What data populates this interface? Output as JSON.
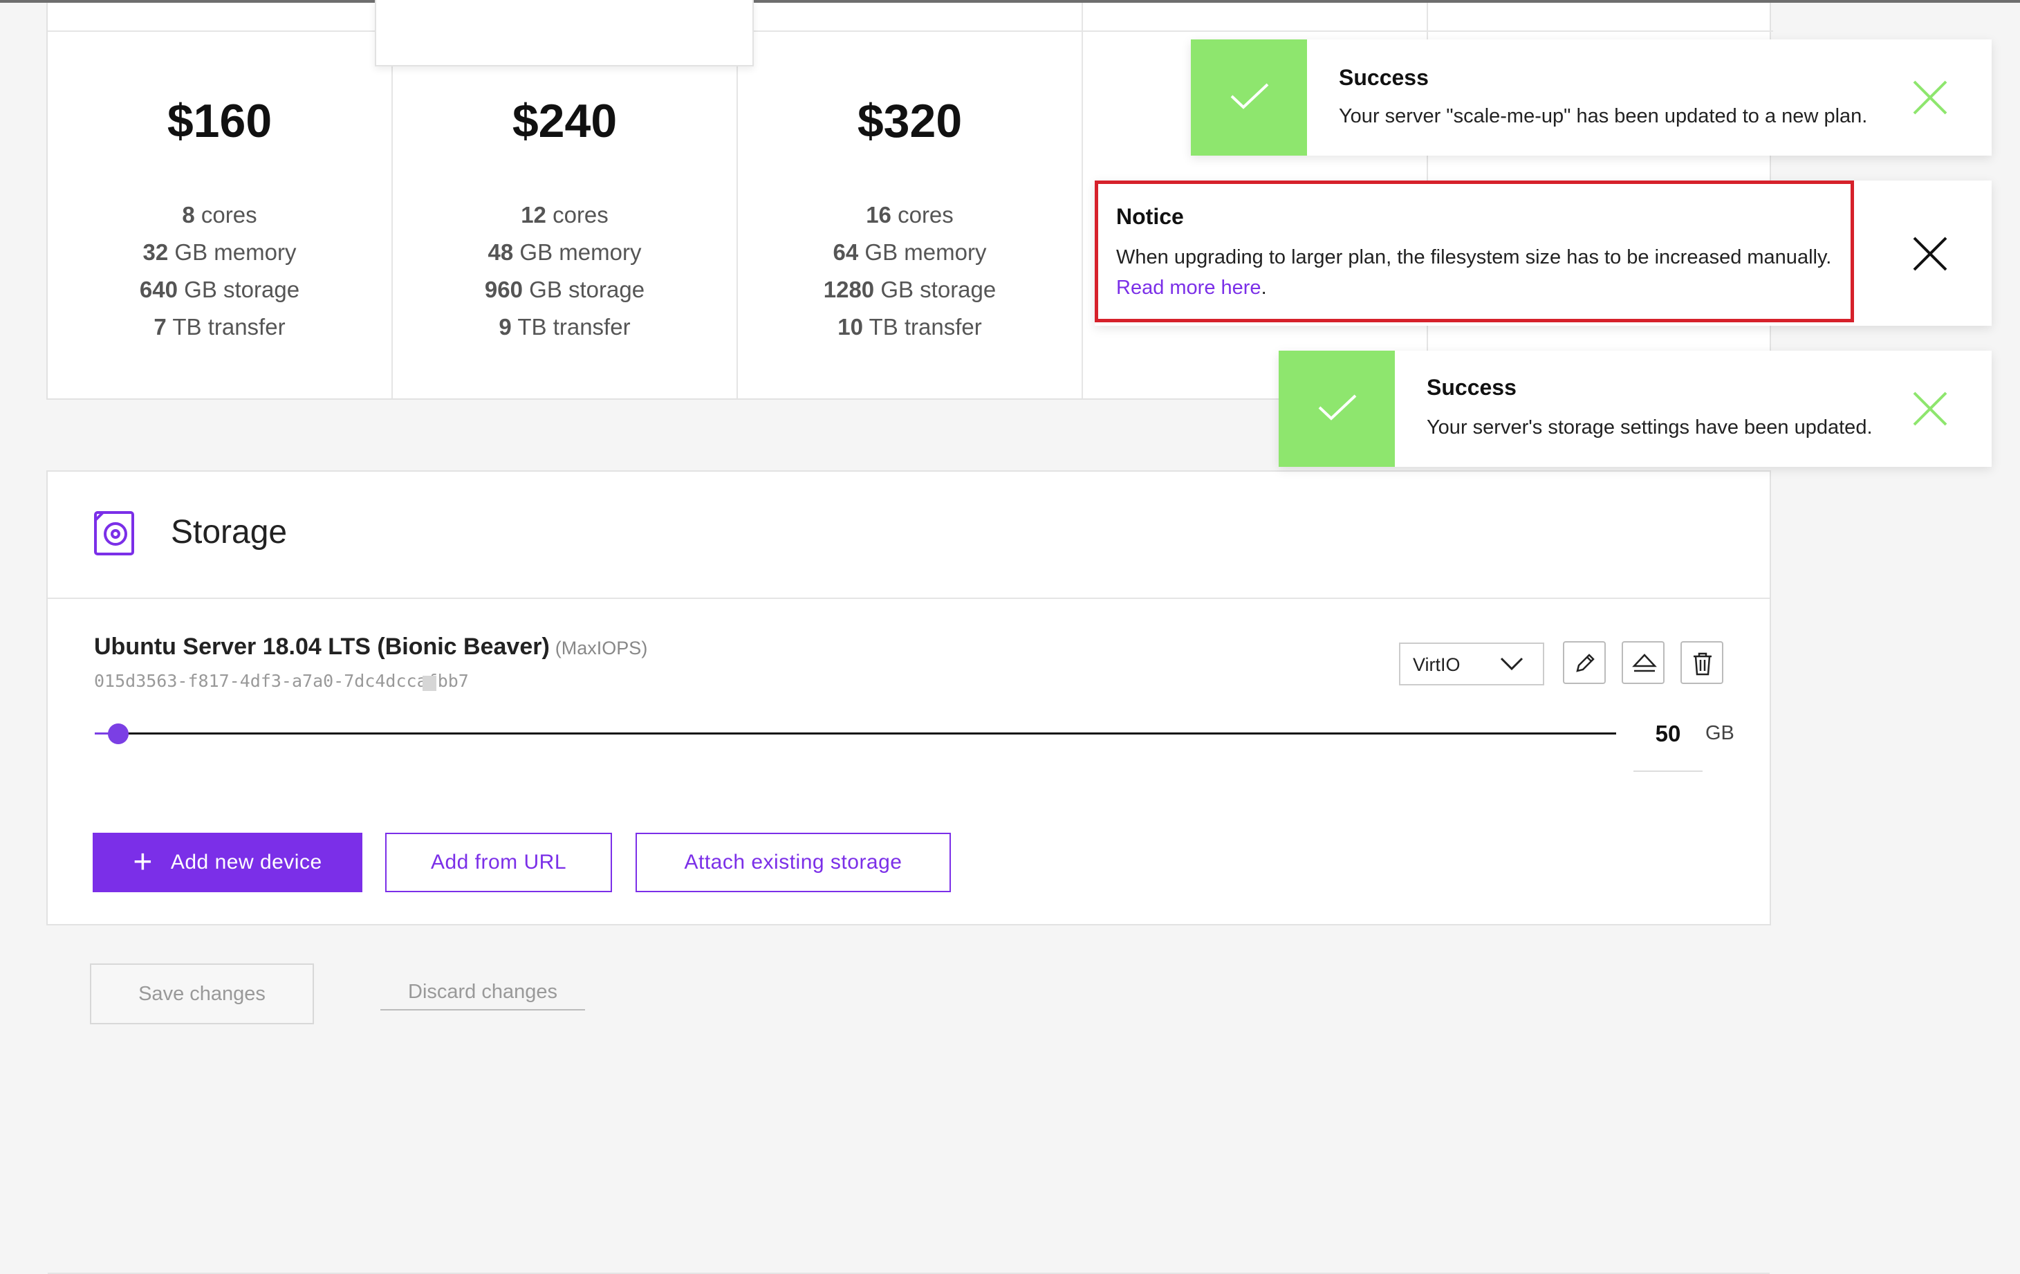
{
  "plans": [
    {
      "price": "$160",
      "cores": "8",
      "cores_label": "cores",
      "memory": "32",
      "memory_label": "GB memory",
      "storage": "640",
      "storage_label": "GB storage",
      "transfer": "7",
      "transfer_label": "TB transfer"
    },
    {
      "price": "$240",
      "cores": "12",
      "cores_label": "cores",
      "memory": "48",
      "memory_label": "GB memory",
      "storage": "960",
      "storage_label": "GB storage",
      "transfer": "9",
      "transfer_label": "TB transfer"
    },
    {
      "price": "$320",
      "cores": "16",
      "cores_label": "cores",
      "memory": "64",
      "memory_label": "GB memory",
      "storage": "1280",
      "storage_label": "GB storage",
      "transfer": "10",
      "transfer_label": "TB transfer"
    }
  ],
  "storage": {
    "title": "Storage",
    "device": {
      "name": "Ubuntu Server 18.04 LTS (Bionic Beaver)",
      "tier": "(MaxIOPS)",
      "uuid": "015d3563-f817-4df3-a7a0-7dc4dccafbb7",
      "controller": "VirtIO",
      "size": "50",
      "unit": "GB"
    },
    "buttons": {
      "add_new": "Add new device",
      "add_url": "Add from URL",
      "attach": "Attach existing storage"
    }
  },
  "footer": {
    "save": "Save changes",
    "discard": "Discard changes"
  },
  "toasts": {
    "success1": {
      "title": "Success",
      "message": "Your server \"scale-me-up\" has been updated to a new plan."
    },
    "notice": {
      "title": "Notice",
      "message": "When upgrading to larger plan, the filesystem size has to be increased manually.",
      "link": "Read more here",
      "after_link": "."
    },
    "success2": {
      "title": "Success",
      "message": "Your server's storage settings have been updated."
    }
  },
  "colors": {
    "accent": "#7b2fe8",
    "success": "#8ee66e",
    "highlight": "#d6212b"
  }
}
